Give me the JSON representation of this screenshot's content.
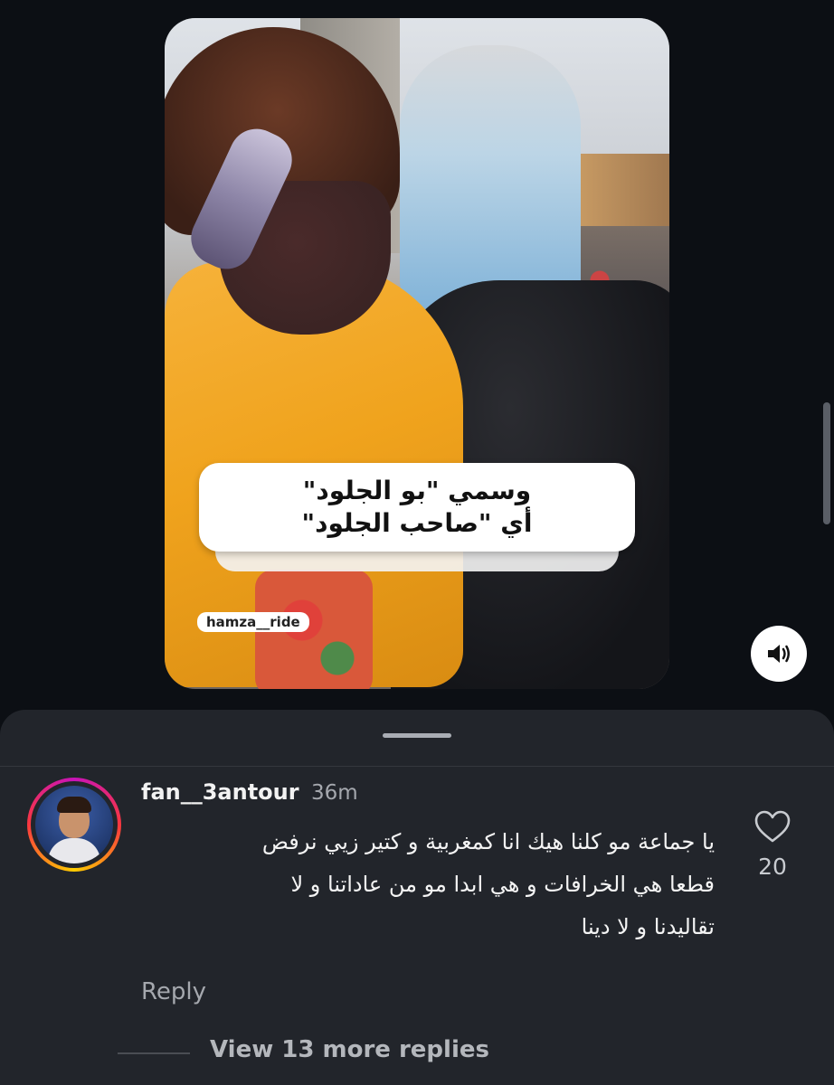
{
  "video": {
    "caption_line_1": "وسمي \"بو الجلود\"",
    "caption_line_2": "أي \"صاحب الجلود\"",
    "watermark": "hamza__ride"
  },
  "sound_button": {
    "icon": "speaker-icon"
  },
  "comment": {
    "username": "fan__3antour",
    "timestamp": "36m",
    "line_1": "يا جماعة مو كلنا هيك انا كمغربية و كتير زيي نرفض",
    "line_2": "قطعا هي الخرافات و هي ابدا مو من عاداتنا و لا",
    "line_3": "تقاليدنا و لا دينا",
    "like_count": "20",
    "reply_label": "Reply",
    "view_replies_label": "View 13 more replies"
  },
  "colors": {
    "background": "#0c0f14",
    "sheet": "#22252b",
    "avatar_ring": [
      "#c913b9",
      "#f9373f",
      "#fecd00"
    ]
  }
}
